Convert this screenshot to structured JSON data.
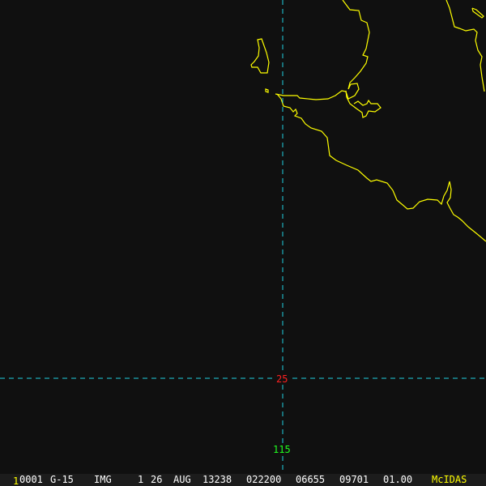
{
  "overlay": {
    "latitude_label": "25",
    "longitude_label": "115",
    "colors": {
      "coastline": "#ffff00",
      "gridline": "#20d0e0",
      "latitude": "#ff2020",
      "longitude": "#20ff20",
      "background": "#101010"
    }
  },
  "status_bar": {
    "frame_marker": "1",
    "frame_number": "0001",
    "satellite": "G-15",
    "source": "IMG",
    "band": "1",
    "day": "26",
    "month": "AUG",
    "julian_date": "13238",
    "time": "022200",
    "line": "06655",
    "element": "09701",
    "resolution": "01.00",
    "brand": "McIDAS"
  }
}
